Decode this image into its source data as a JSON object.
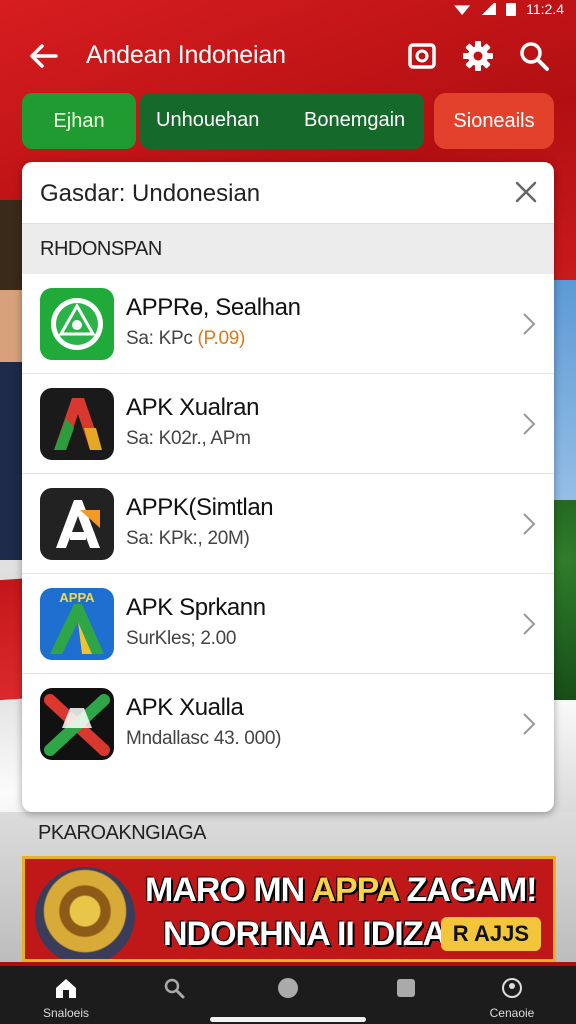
{
  "status_bar": {
    "time": "11:2.4"
  },
  "app_bar": {
    "title": "Andean Indoneian"
  },
  "chips": [
    {
      "label": "Ejhan"
    },
    {
      "label": "Unhouehan"
    },
    {
      "label": "Bonemgain"
    },
    {
      "label": "Sioneails"
    }
  ],
  "search": {
    "value": "Gasdar: Undonesian"
  },
  "results_section": {
    "title": "RHDONSPAN"
  },
  "results": [
    {
      "name": "APPRɵ, Sealhan",
      "sub_prefix": "Sa: KPc",
      "sub_highlight": "(P.09)"
    },
    {
      "name": "APK Xualran",
      "sub_prefix": "Sa: K02r., APm",
      "sub_highlight": ""
    },
    {
      "name": "APPK(Simtlan",
      "sub_prefix": "Sa: KPk:, 20M)",
      "sub_highlight": ""
    },
    {
      "name": "APK Sprkann",
      "sub_prefix": "SurKles; 2.00",
      "sub_highlight": ""
    },
    {
      "name": "APK Xualla",
      "sub_prefix": "Mndallasc 43. 000)",
      "sub_highlight": ""
    }
  ],
  "icon_texts": {
    "app4": "APPA"
  },
  "lower_section": {
    "title": "PKAROAKNGIAGA"
  },
  "banner": {
    "line1_white_a": "MARO MN ",
    "line1_yellow": "APPA",
    "line1_white_b": " ZAGAM!",
    "line2": "NDORHNA II IDIZAN",
    "badge": "R AJJS"
  },
  "bottom_nav": [
    {
      "label": "Snaloeis",
      "icon": "home-icon"
    },
    {
      "label": "",
      "icon": "search-icon"
    },
    {
      "label": "",
      "icon": "circle-icon"
    },
    {
      "label": "",
      "icon": "square-icon"
    },
    {
      "label": "Cenaoie",
      "icon": "profile-icon"
    }
  ],
  "colors": {
    "chip_green": "#1f9b32",
    "chip_darkgreen": "#15692a",
    "chip_red": "#e3412c",
    "highlight_orange": "#e0781a",
    "banner_red": "#c01818",
    "banner_gold": "#e6b123"
  }
}
